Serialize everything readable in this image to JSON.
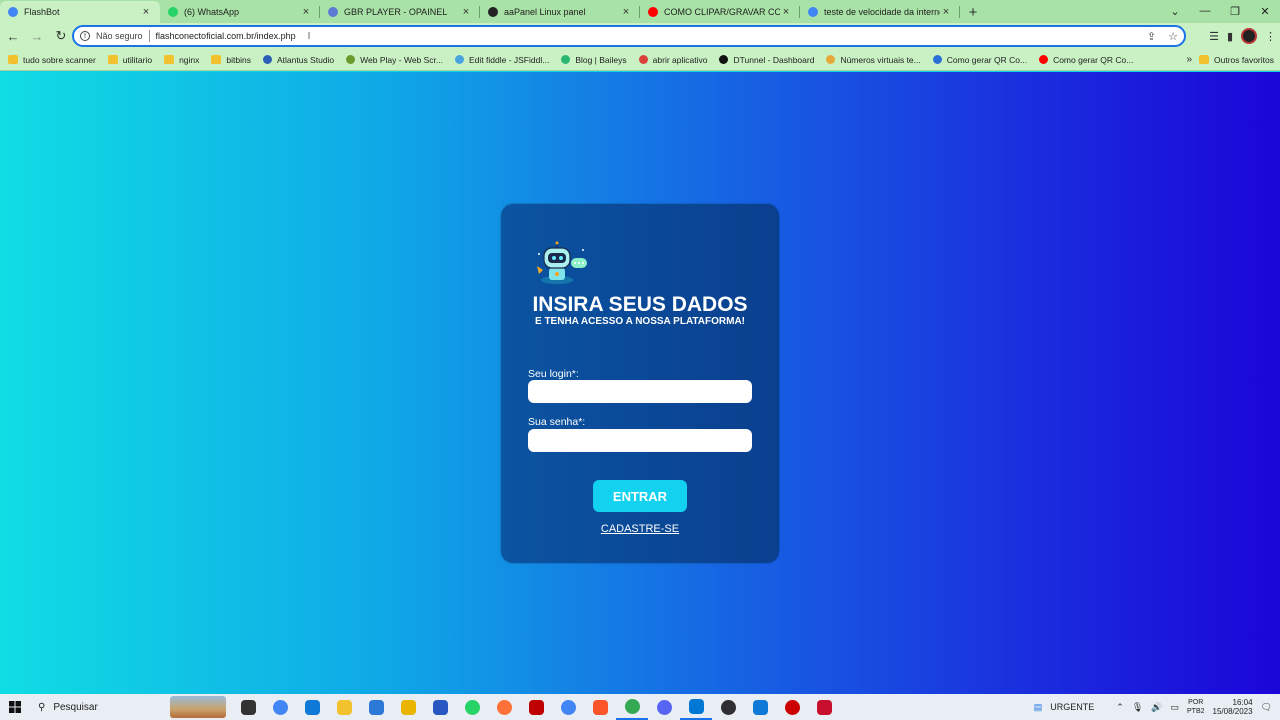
{
  "browser": {
    "tabs": [
      {
        "title": "FlashBot",
        "icon": "chrome-icon",
        "color": "#4285f4",
        "active": true
      },
      {
        "title": "(6) WhatsApp",
        "icon": "whatsapp-icon",
        "color": "#25d366"
      },
      {
        "title": "GBR PLAYER - OPAINEL",
        "icon": "gear-icon",
        "color": "#5b7bd5"
      },
      {
        "title": "aaPanel Linux panel",
        "icon": "bt-icon",
        "color": "#222222"
      },
      {
        "title": "COMO CLIPAR/GRAVAR COM PL",
        "icon": "youtube-icon",
        "color": "#ff0000"
      },
      {
        "title": "teste de velocidade da internet -",
        "icon": "google-icon",
        "color": "#4285f4"
      }
    ],
    "address": {
      "security": "Não seguro",
      "url": "flashconectoficial.com.br/index.php"
    },
    "bookmarks": [
      {
        "label": "tudo sobre scanner",
        "type": "folder"
      },
      {
        "label": "utilitario",
        "type": "folder"
      },
      {
        "label": "nginx",
        "type": "folder"
      },
      {
        "label": "bitbins",
        "type": "folder"
      },
      {
        "label": "Atlantus Studio",
        "type": "site",
        "color": "#2b5fb8"
      },
      {
        "label": "Web Play - Web Scr...",
        "type": "site",
        "color": "#6a9a2a"
      },
      {
        "label": "Edit fiddle - JSFiddl...",
        "type": "site",
        "color": "#4aa3df"
      },
      {
        "label": "Blog | Baileys",
        "type": "site",
        "color": "#2bb673"
      },
      {
        "label": "abrir aplicativo",
        "type": "site",
        "color": "#d9413c"
      },
      {
        "label": "DTunnel - Dashboard",
        "type": "site",
        "color": "#111111"
      },
      {
        "label": "Números virtuais te...",
        "type": "site",
        "color": "#e7a83a"
      },
      {
        "label": "Como gerar QR Co...",
        "type": "site",
        "color": "#2a6fd6"
      },
      {
        "label": "Como gerar QR Co...",
        "type": "site",
        "color": "#ff0000"
      }
    ],
    "bookmarks_more": "»",
    "other_bookmarks": "Outros favoritos"
  },
  "login": {
    "title": "INSIRA SEUS DADOS",
    "subtitle": "E TENHA ACESSO A NOSSA PLATAFORMA!",
    "login_label": "Seu login*:",
    "password_label": "Sua senha*:",
    "submit": "ENTRAR",
    "signup": "CADASTRE-SE"
  },
  "taskbar": {
    "search_placeholder": "Pesquisar",
    "apps": [
      "file-explorer",
      "chrome",
      "edge",
      "folder",
      "mail",
      "norton",
      "store",
      "whatsapp",
      "firefox",
      "filezilla",
      "chrome-2",
      "brave",
      "chrome-3",
      "discord",
      "vscode",
      "obs",
      "edge-2",
      "record",
      "vpn"
    ],
    "weather_label": "URGENTE",
    "lang_top": "POR",
    "lang_bottom": "PTB2",
    "time": "16:04",
    "date": "15/08/2023"
  }
}
